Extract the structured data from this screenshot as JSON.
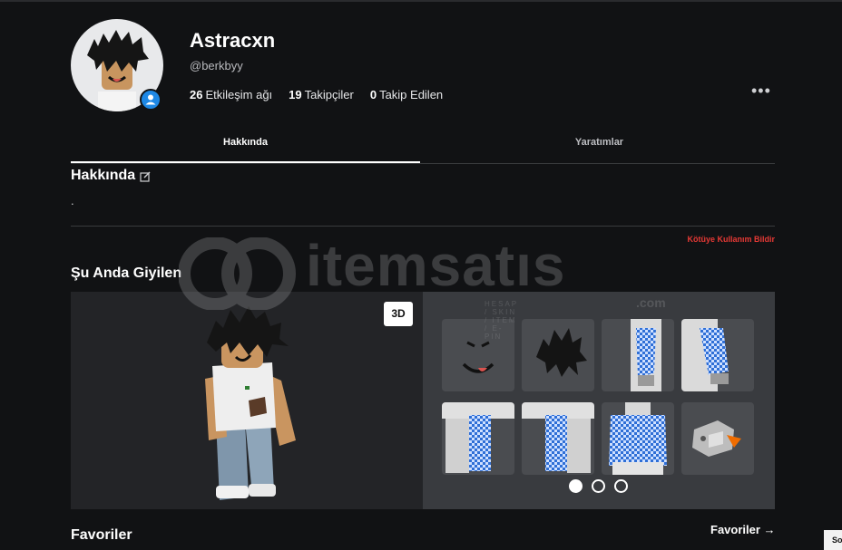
{
  "profile": {
    "display_name": "Astracxn",
    "username": "@berkbyy",
    "stats": [
      {
        "value": "26",
        "label": "Etkileşim ağı"
      },
      {
        "value": "19",
        "label": "Takipçiler"
      },
      {
        "value": "0",
        "label": "Takip Edilen"
      }
    ],
    "more_label": "•••"
  },
  "tabs": [
    {
      "label": "Hakkında",
      "active": true
    },
    {
      "label": "Yaratımlar",
      "active": false
    }
  ],
  "about": {
    "title": "Hakkında",
    "text": ".",
    "report_link": "Kötüye Kullanım Bildir"
  },
  "wearing": {
    "title": "Şu Anda Giyilen",
    "toggle_3d": "3D",
    "items": [
      {
        "name": "face-item",
        "icon": "smile-face"
      },
      {
        "name": "hair-item",
        "icon": "black-hair"
      },
      {
        "name": "left-arm-item",
        "icon": "checker-sleeve-arm"
      },
      {
        "name": "right-arm-item",
        "icon": "checker-sleeve-arm"
      },
      {
        "name": "left-leg-item",
        "icon": "checker-leg"
      },
      {
        "name": "right-leg-item",
        "icon": "checker-leg"
      },
      {
        "name": "torso-item",
        "icon": "checker-torso"
      },
      {
        "name": "accessory-item",
        "icon": "toy-accessory"
      }
    ],
    "page_count": 3,
    "active_page": 1
  },
  "favorites": {
    "title": "Favoriler",
    "link_label": "Favoriler",
    "link_arrow": "→"
  },
  "watermark": {
    "brand": "itemsatıs",
    "tagline": "HESAP / SKIN / ITEM / E-PIN",
    "suffix": ".com"
  },
  "corner_tag": "So",
  "colors": {
    "background": "#111214",
    "panel_left": "#232427",
    "panel_right": "#393b3f",
    "report_red": "#e53935",
    "verified_blue": "#1e88e5",
    "checker_blue": "#2f6fd6"
  }
}
